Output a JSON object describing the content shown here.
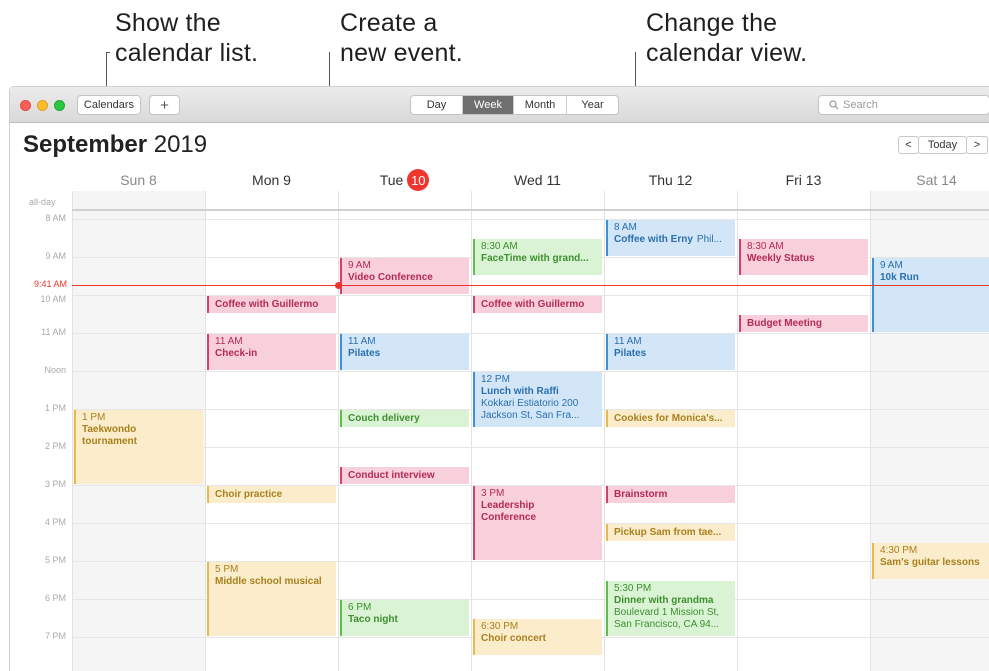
{
  "callouts": {
    "list": [
      "Show the",
      "calendar list."
    ],
    "create": [
      "Create a",
      "new event."
    ],
    "view": [
      "Change the",
      "calendar view."
    ]
  },
  "toolbar": {
    "calendars_label": "Calendars",
    "add_label": "+",
    "views": [
      "Day",
      "Week",
      "Month",
      "Year"
    ],
    "active_view": "Week",
    "search_placeholder": "Search"
  },
  "header": {
    "month": "September",
    "year": "2019",
    "today_label": "Today",
    "prev": "<",
    "next": ">"
  },
  "days": [
    {
      "label": "Sun 8"
    },
    {
      "label": "Mon 9"
    },
    {
      "label": "Tue",
      "num": "10"
    },
    {
      "label": "Wed 11"
    },
    {
      "label": "Thu 12"
    },
    {
      "label": "Fri 13"
    },
    {
      "label": "Sat 14"
    }
  ],
  "all_day_label": "all-day",
  "hours": [
    "8 AM",
    "9 AM",
    "10 AM",
    "11 AM",
    "Noon",
    "1 PM",
    "2 PM",
    "3 PM",
    "4 PM",
    "5 PM",
    "6 PM",
    "7 PM"
  ],
  "now_label": "9:41 AM",
  "events": [
    {
      "day": 0,
      "start": 13.0,
      "end": 15.0,
      "color": "yellow",
      "time": "1 PM",
      "name": "Taekwondo",
      "sub": "tournament",
      "sub_bold": true
    },
    {
      "day": 1,
      "start": 10.0,
      "end": 10.5,
      "color": "red",
      "name": "Coffee with Guillermo"
    },
    {
      "day": 1,
      "start": 11.0,
      "end": 12.0,
      "color": "red",
      "time": "11 AM",
      "name": "Check-in"
    },
    {
      "day": 1,
      "start": 15.0,
      "end": 15.5,
      "color": "yellow",
      "name": "Choir practice"
    },
    {
      "day": 1,
      "start": 17.0,
      "end": 19.0,
      "color": "yellow",
      "time": "5 PM",
      "name": "Middle school musical"
    },
    {
      "day": 2,
      "start": 9.0,
      "end": 10.0,
      "color": "red",
      "time": "9 AM",
      "name": "Video Conference"
    },
    {
      "day": 2,
      "start": 11.0,
      "end": 12.0,
      "color": "blue",
      "time": "11 AM",
      "name": "Pilates"
    },
    {
      "day": 2,
      "start": 13.0,
      "end": 13.5,
      "color": "green",
      "name": "Couch delivery"
    },
    {
      "day": 2,
      "start": 14.5,
      "end": 15.0,
      "color": "red",
      "name": "Conduct interview"
    },
    {
      "day": 2,
      "start": 18.0,
      "end": 19.0,
      "color": "green",
      "time": "6 PM",
      "name": "Taco night"
    },
    {
      "day": 3,
      "start": 8.5,
      "end": 9.5,
      "color": "green",
      "time": "8:30 AM",
      "name": "FaceTime with grand..."
    },
    {
      "day": 3,
      "start": 10.0,
      "end": 10.5,
      "color": "red",
      "name": "Coffee with Guillermo"
    },
    {
      "day": 3,
      "start": 12.0,
      "end": 13.5,
      "color": "blue",
      "time": "12 PM",
      "name": "Lunch with Raffi",
      "sub": "Kokkari Estiatorio 200",
      "sub2": "Jackson St, San Fra..."
    },
    {
      "day": 3,
      "start": 15.0,
      "end": 17.0,
      "color": "red",
      "time": "3 PM",
      "name": "Leadership",
      "sub": "Conference",
      "sub_bold": true
    },
    {
      "day": 3,
      "start": 18.5,
      "end": 19.5,
      "color": "yellow",
      "time": "6:30 PM",
      "name": "Choir concert"
    },
    {
      "day": 4,
      "start": 8.0,
      "end": 9.0,
      "color": "blue",
      "time": "8 AM",
      "name": "Coffee with Erny",
      "extra": "Phil..."
    },
    {
      "day": 4,
      "start": 11.0,
      "end": 12.0,
      "color": "blue",
      "time": "11 AM",
      "name": "Pilates"
    },
    {
      "day": 4,
      "start": 13.0,
      "end": 13.5,
      "color": "yellow",
      "name": "Cookies for Monica's..."
    },
    {
      "day": 4,
      "start": 15.0,
      "end": 15.5,
      "color": "red",
      "name": "Brainstorm"
    },
    {
      "day": 4,
      "start": 16.0,
      "end": 16.5,
      "color": "yellow",
      "name": "Pickup Sam from tae..."
    },
    {
      "day": 4,
      "start": 17.5,
      "end": 19.0,
      "color": "green",
      "time": "5:30 PM",
      "name": "Dinner with grandma",
      "sub": "Boulevard 1 Mission St,",
      "sub2": "San Francisco, CA  94..."
    },
    {
      "day": 5,
      "start": 8.5,
      "end": 9.5,
      "color": "red",
      "time": "8:30 AM",
      "name": "Weekly Status"
    },
    {
      "day": 5,
      "start": 10.5,
      "end": 11.0,
      "color": "red",
      "name": "Budget Meeting"
    },
    {
      "day": 6,
      "start": 9.0,
      "end": 11.0,
      "color": "blue",
      "time": "9 AM",
      "name": "10k Run"
    },
    {
      "day": 6,
      "start": 16.5,
      "end": 17.5,
      "color": "yellow",
      "time": "4:30 PM",
      "name": "Sam's guitar lessons"
    }
  ]
}
